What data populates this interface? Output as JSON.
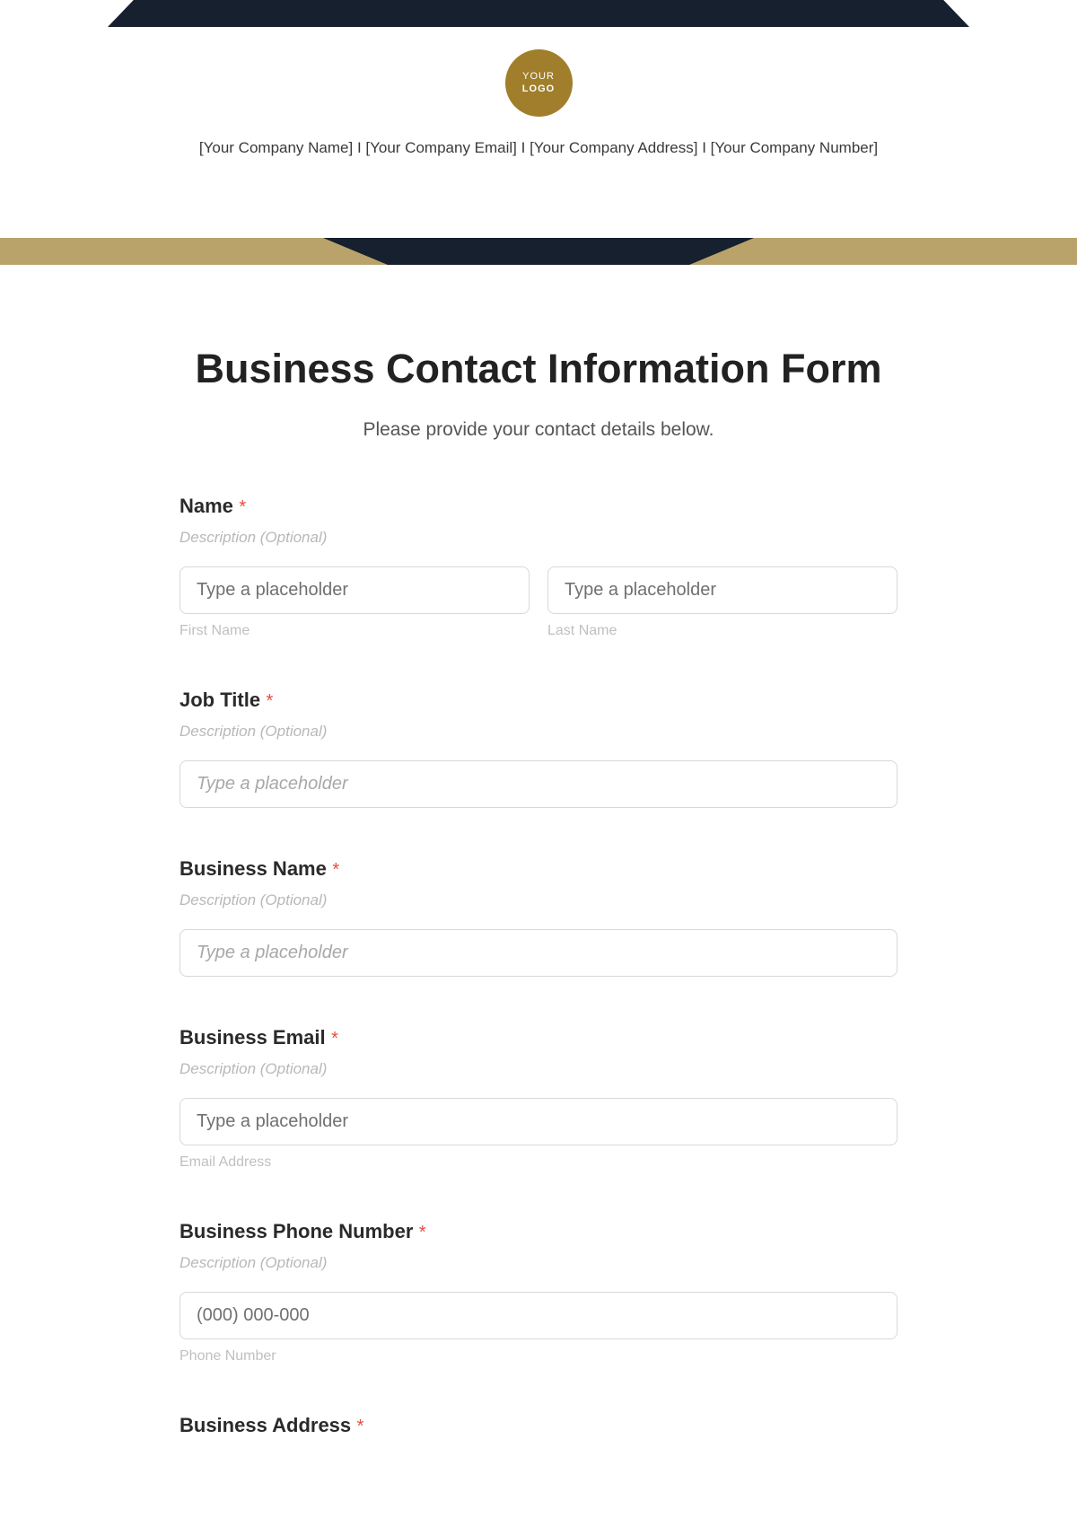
{
  "header": {
    "logo_your": "YOUR",
    "logo_logo": "LOGO",
    "company_info": "[Your Company Name] I [Your Company Email] I [Your Company Address] I [Your Company Number]"
  },
  "form": {
    "title": "Business Contact Information Form",
    "subtitle": "Please provide your contact details below.",
    "fields": {
      "name": {
        "label": "Name",
        "description": "Description (Optional)",
        "first_placeholder": "Type a placeholder",
        "last_placeholder": "Type a placeholder",
        "first_sublabel": "First Name",
        "last_sublabel": "Last Name"
      },
      "job_title": {
        "label": "Job Title",
        "description": "Description (Optional)",
        "placeholder": "Type a placeholder"
      },
      "business_name": {
        "label": "Business Name",
        "description": "Description (Optional)",
        "placeholder": "Type a placeholder"
      },
      "business_email": {
        "label": "Business Email",
        "description": "Description (Optional)",
        "placeholder": "Type a placeholder",
        "sublabel": "Email Address"
      },
      "business_phone": {
        "label": "Business Phone Number",
        "description": "Description (Optional)",
        "placeholder": "(000) 000-000",
        "sublabel": "Phone Number"
      },
      "business_address": {
        "label": "Business Address"
      }
    },
    "required_marker": "*"
  }
}
